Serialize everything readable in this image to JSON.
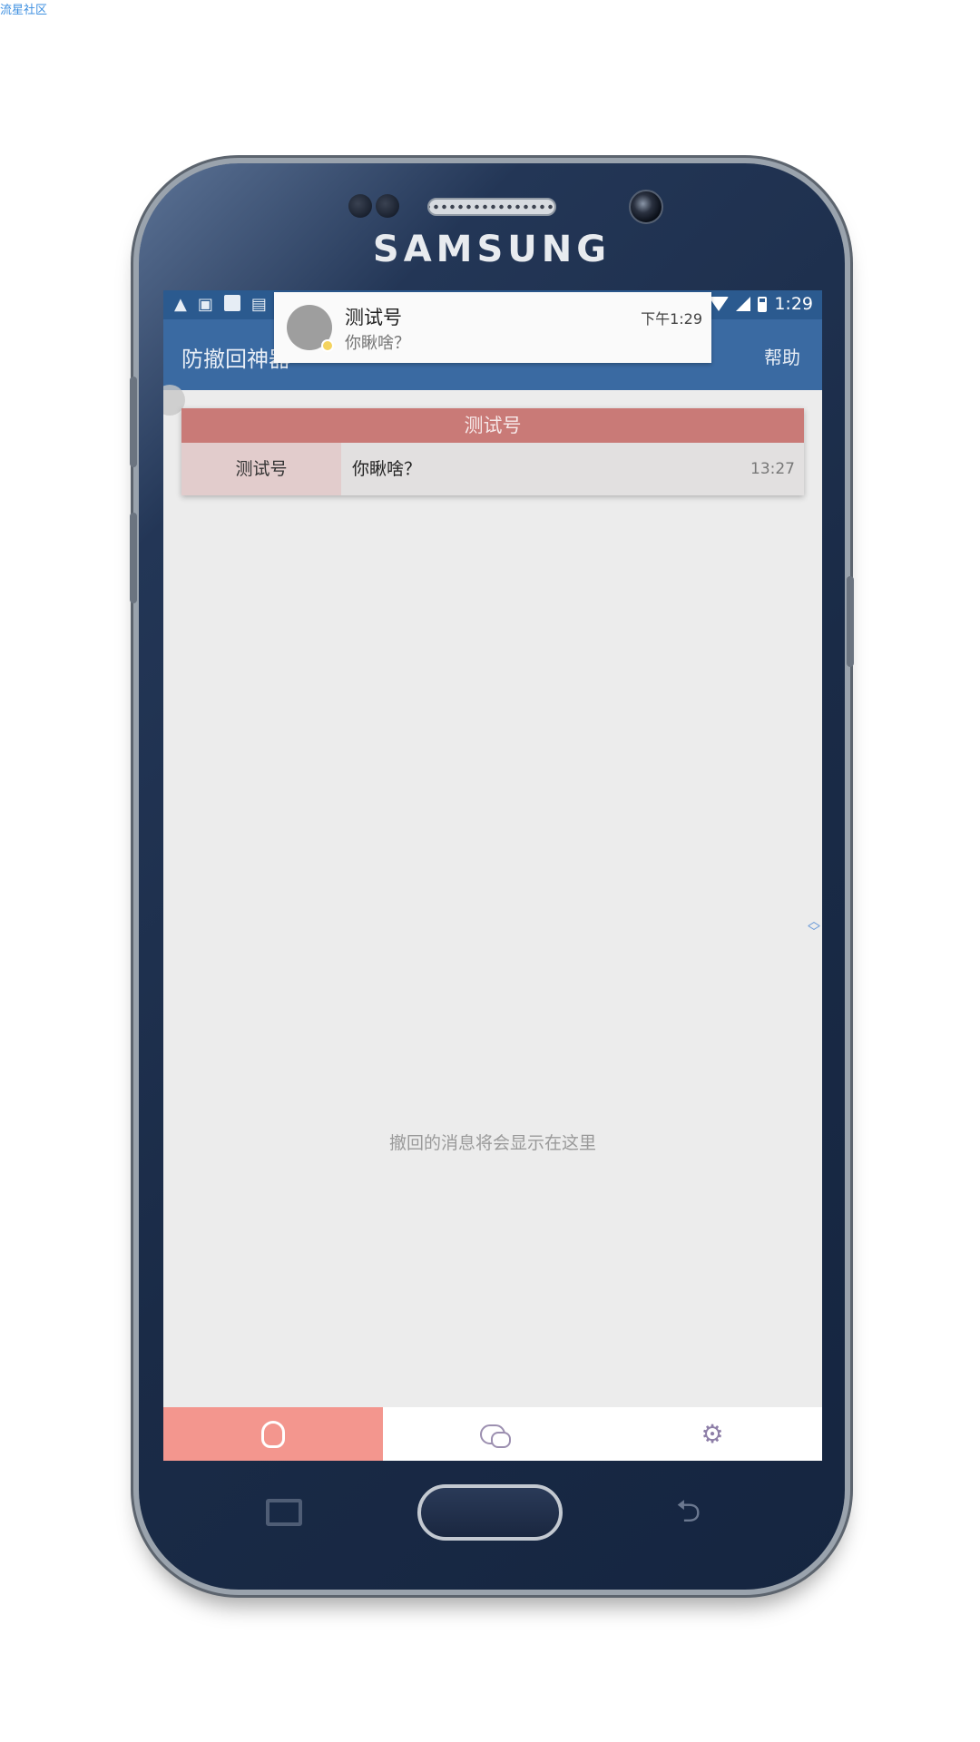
{
  "watermark": "流星社区",
  "device": {
    "brand": "SAMSUNG"
  },
  "status_bar": {
    "icons": [
      "warning-icon",
      "image-icon",
      "app-icon",
      "text-icon"
    ],
    "time": "1:29"
  },
  "app_bar": {
    "title": "防撤回神器",
    "help_label": "帮助"
  },
  "notification": {
    "title": "测试号",
    "message": "你瞅啥？",
    "time": "下午1:29"
  },
  "recalled_card": {
    "header": "测试号",
    "sender": "测试号",
    "message": "你瞅啥？",
    "time": "13:27"
  },
  "empty_hint": "撤回的消息将会显示在这里",
  "bottom_nav": {
    "tabs": [
      {
        "icon": "qq-penguin-icon",
        "active": true
      },
      {
        "icon": "wechat-icon",
        "active": false
      },
      {
        "icon": "gear-icon",
        "active": false
      }
    ],
    "colors": {
      "active_bg": "#f3968e",
      "inactive_icon": "#8e7fa8"
    }
  },
  "colors": {
    "status_bar": "#2b5a8f",
    "app_bar": "#3a6aa2",
    "card_header": "#c97a77"
  }
}
